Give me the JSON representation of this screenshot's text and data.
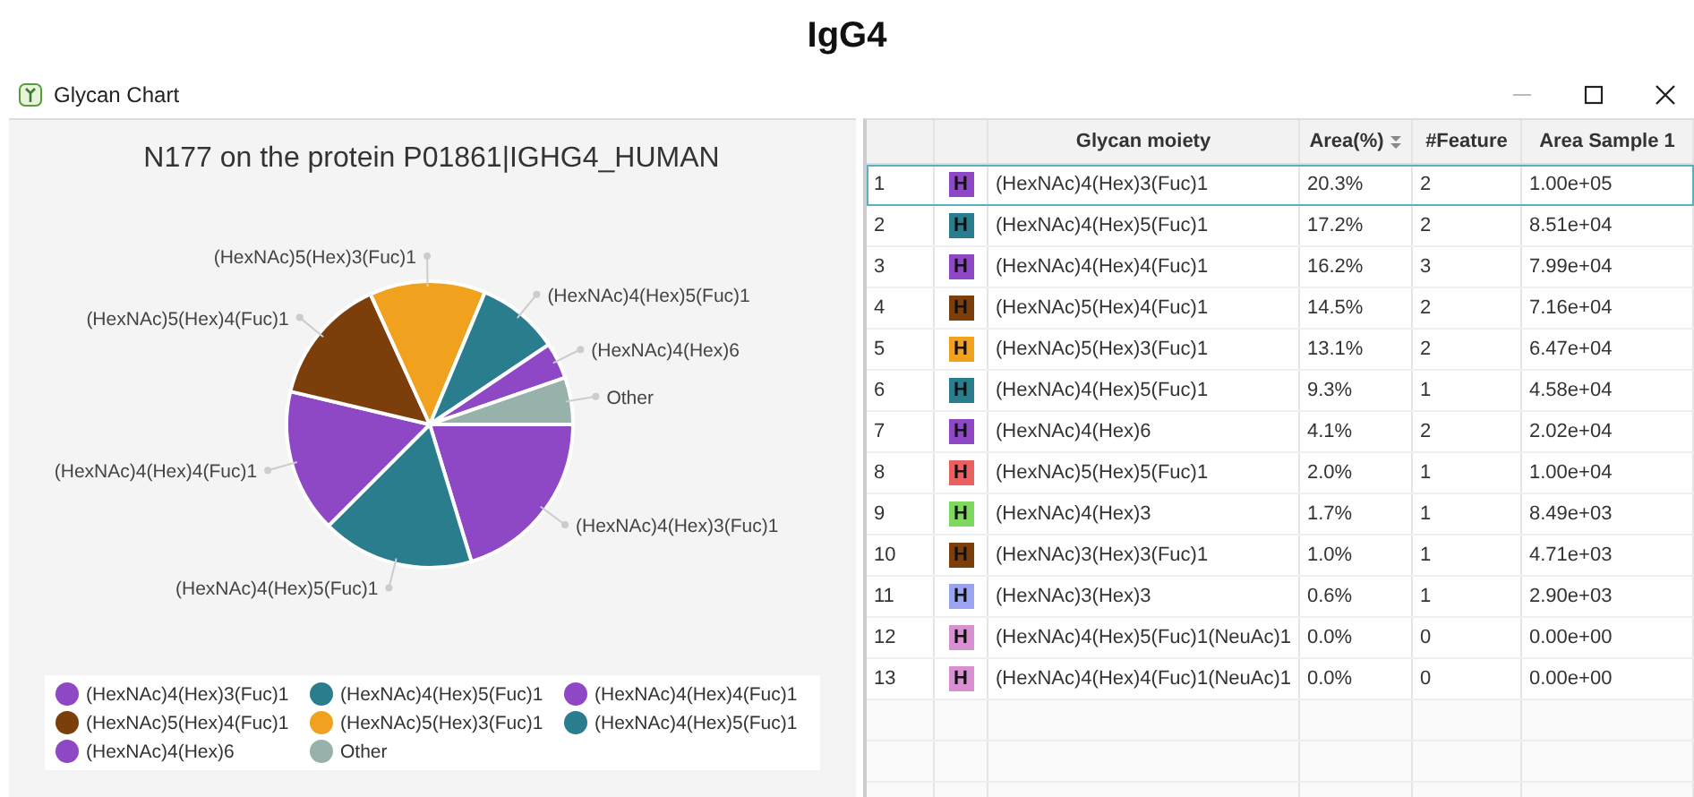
{
  "page_title": "IgG4",
  "window": {
    "title": "Glycan Chart",
    "minimize_disabled": true
  },
  "chart": {
    "chart_data": {
      "type": "pie",
      "title": "N177 on the protein P01861|IGHG4_HUMAN",
      "categories": [
        "(HexNAc)4(Hex)3(Fuc)1",
        "(HexNAc)4(Hex)5(Fuc)1",
        "(HexNAc)4(Hex)4(Fuc)1",
        "(HexNAc)5(Hex)4(Fuc)1",
        "(HexNAc)5(Hex)3(Fuc)1",
        "(HexNAc)4(Hex)5(Fuc)1",
        "(HexNAc)4(Hex)6",
        "Other"
      ],
      "values": [
        20.3,
        17.2,
        16.2,
        14.5,
        13.1,
        9.3,
        4.1,
        5.3
      ]
    },
    "legend": [
      {
        "label": "(HexNAc)4(Hex)3(Fuc)1",
        "color": "#8e48c6"
      },
      {
        "label": "(HexNAc)4(Hex)5(Fuc)1",
        "color": "#2a7d8c"
      },
      {
        "label": "(HexNAc)4(Hex)4(Fuc)1",
        "color": "#8e48c6"
      },
      {
        "label": "(HexNAc)5(Hex)4(Fuc)1",
        "color": "#7c3f0c"
      },
      {
        "label": "(HexNAc)5(Hex)3(Fuc)1",
        "color": "#f0a21e"
      },
      {
        "label": "(HexNAc)4(Hex)5(Fuc)1",
        "color": "#2a7d8c"
      },
      {
        "label": "(HexNAc)4(Hex)6",
        "color": "#8e48c6"
      },
      {
        "label": "Other",
        "color": "#96b2aa"
      }
    ]
  },
  "table": {
    "columns": [
      {
        "label": "Glycan moiety",
        "sorted": false
      },
      {
        "label": "Area(%)",
        "sorted": true
      },
      {
        "label": "#Feature",
        "sorted": false
      },
      {
        "label": "Area Sample 1",
        "sorted": false
      }
    ],
    "rows": [
      {
        "index": "1",
        "icon": "H",
        "color": "#8e48c6",
        "glycan": "(HexNAc)4(Hex)3(Fuc)1",
        "area_pct": "20.3%",
        "features": "2",
        "area_sample_1": "1.00e+05",
        "selected": true
      },
      {
        "index": "2",
        "icon": "H",
        "color": "#2a7d8c",
        "glycan": "(HexNAc)4(Hex)5(Fuc)1",
        "area_pct": "17.2%",
        "features": "2",
        "area_sample_1": "8.51e+04",
        "selected": false
      },
      {
        "index": "3",
        "icon": "H",
        "color": "#8e48c6",
        "glycan": "(HexNAc)4(Hex)4(Fuc)1",
        "area_pct": "16.2%",
        "features": "3",
        "area_sample_1": "7.99e+04",
        "selected": false
      },
      {
        "index": "4",
        "icon": "H",
        "color": "#7c3f0c",
        "glycan": "(HexNAc)5(Hex)4(Fuc)1",
        "area_pct": "14.5%",
        "features": "2",
        "area_sample_1": "7.16e+04",
        "selected": false
      },
      {
        "index": "5",
        "icon": "H",
        "color": "#f0a21e",
        "glycan": "(HexNAc)5(Hex)3(Fuc)1",
        "area_pct": "13.1%",
        "features": "2",
        "area_sample_1": "6.47e+04",
        "selected": false
      },
      {
        "index": "6",
        "icon": "H",
        "color": "#2a7d8c",
        "glycan": "(HexNAc)4(Hex)5(Fuc)1",
        "area_pct": "9.3%",
        "features": "1",
        "area_sample_1": "4.58e+04",
        "selected": false
      },
      {
        "index": "7",
        "icon": "H",
        "color": "#8e48c6",
        "glycan": "(HexNAc)4(Hex)6",
        "area_pct": "4.1%",
        "features": "2",
        "area_sample_1": "2.02e+04",
        "selected": false
      },
      {
        "index": "8",
        "icon": "H",
        "color": "#e86060",
        "glycan": "(HexNAc)5(Hex)5(Fuc)1",
        "area_pct": "2.0%",
        "features": "1",
        "area_sample_1": "1.00e+04",
        "selected": false
      },
      {
        "index": "9",
        "icon": "H",
        "color": "#7ed860",
        "glycan": "(HexNAc)4(Hex)3",
        "area_pct": "1.7%",
        "features": "1",
        "area_sample_1": "8.49e+03",
        "selected": false
      },
      {
        "index": "10",
        "icon": "H",
        "color": "#7c3f0c",
        "glycan": "(HexNAc)3(Hex)3(Fuc)1",
        "area_pct": "1.0%",
        "features": "1",
        "area_sample_1": "4.71e+03",
        "selected": false
      },
      {
        "index": "11",
        "icon": "H",
        "color": "#9aa4f0",
        "glycan": "(HexNAc)3(Hex)3",
        "area_pct": "0.6%",
        "features": "1",
        "area_sample_1": "2.90e+03",
        "selected": false
      },
      {
        "index": "12",
        "icon": "H",
        "color": "#d890d0",
        "glycan": "(HexNAc)4(Hex)5(Fuc)1(NeuAc)1",
        "area_pct": "0.0%",
        "features": "0",
        "area_sample_1": "0.00e+00",
        "selected": false
      },
      {
        "index": "13",
        "icon": "H",
        "color": "#d890d0",
        "glycan": "(HexNAc)4(Hex)4(Fuc)1(NeuAc)1",
        "area_pct": "0.0%",
        "features": "0",
        "area_sample_1": "0.00e+00",
        "selected": false
      }
    ]
  }
}
